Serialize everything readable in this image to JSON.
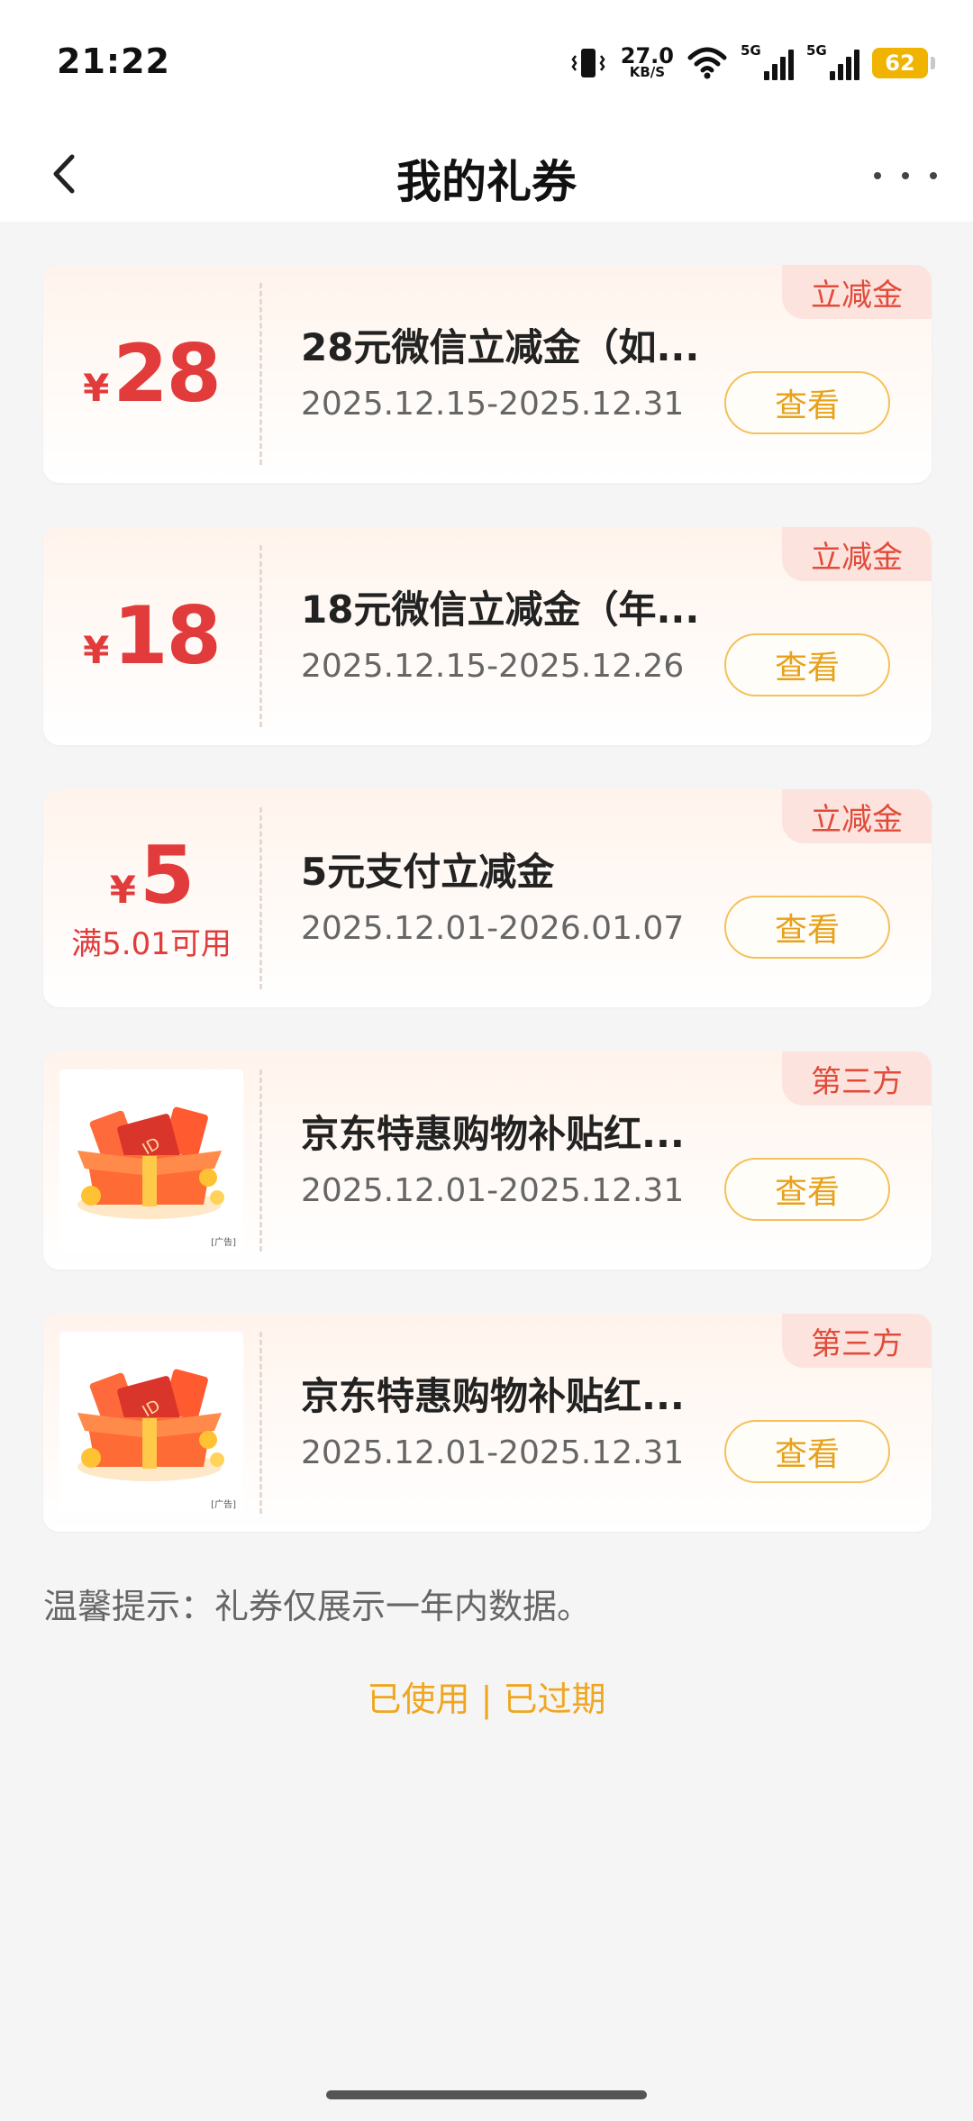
{
  "status_bar": {
    "time": "21:22",
    "net_speed": "27.0",
    "net_unit": "KB/S",
    "signal_1": "5G",
    "signal_2": "5G",
    "battery": "62"
  },
  "header": {
    "title": "我的礼券"
  },
  "coupons": [
    {
      "currency": "¥",
      "amount": "28",
      "condition": "",
      "name": "28元微信立减金（如...",
      "date": "2025.12.15-2025.12.31",
      "action": "查看",
      "badge": "立减金"
    },
    {
      "currency": "¥",
      "amount": "18",
      "condition": "",
      "name": "18元微信立减金（年...",
      "date": "2025.12.15-2025.12.26",
      "action": "查看",
      "badge": "立减金"
    },
    {
      "currency": "¥",
      "amount": "5",
      "condition": "满5.01可用",
      "name": "5元支付立减金",
      "date": "2025.12.01-2026.01.07",
      "action": "查看",
      "badge": "立减金"
    },
    {
      "image": "gift-box-red-packet",
      "name": "京东特惠购物补贴红...",
      "date": "2025.12.01-2025.12.31",
      "action": "查看",
      "badge": "第三方"
    },
    {
      "image": "gift-box-red-packet",
      "name": "京东特惠购物补贴红...",
      "date": "2025.12.01-2025.12.31",
      "action": "查看",
      "badge": "第三方"
    }
  ],
  "footer": {
    "tip": "温馨提示：礼券仅展示一年内数据。",
    "used": "已使用",
    "separator": "|",
    "expired": "已过期"
  },
  "colors": {
    "accent_red": "#e23b3b",
    "accent_orange": "#f0a61f",
    "badge_bg": "#fde3de"
  }
}
